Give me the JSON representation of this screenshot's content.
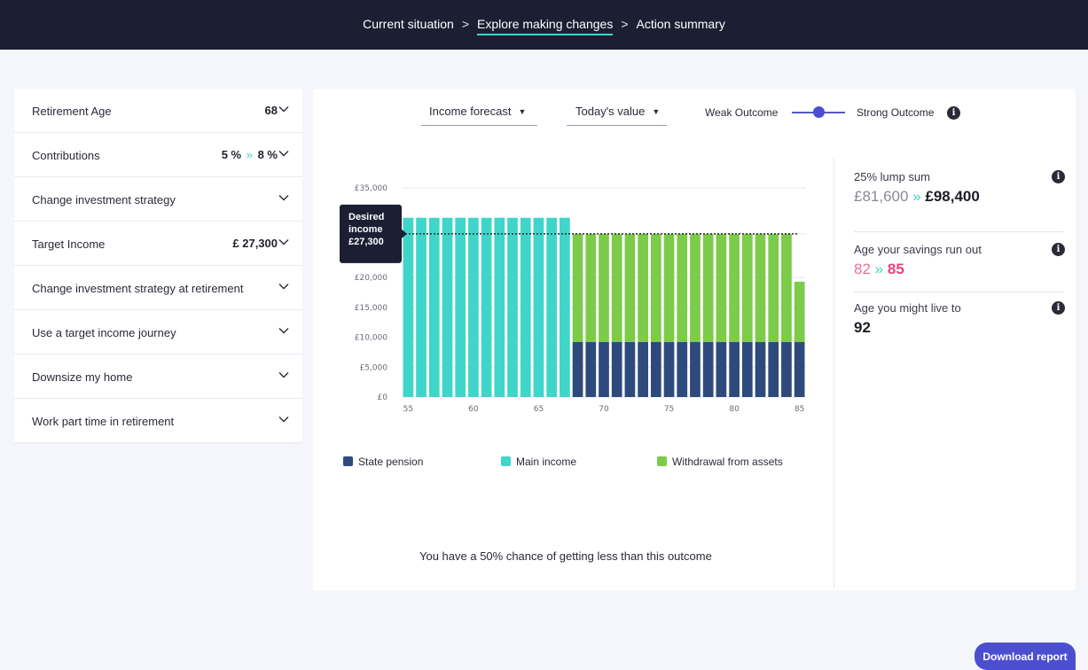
{
  "breadcrumb": {
    "items": [
      "Current situation",
      "Explore making changes",
      "Action summary"
    ],
    "separator": ">",
    "active_index": 1
  },
  "sidebar": {
    "items": [
      {
        "label": "Retirement Age",
        "value": "68"
      },
      {
        "label": "Contributions",
        "value_from": "5 %",
        "arrows": "»",
        "value_to": "8 %"
      },
      {
        "label": "Change investment strategy",
        "value": ""
      },
      {
        "label": "Target Income",
        "value": "£ 27,300"
      },
      {
        "label": "Change investment strategy at retirement",
        "value": ""
      },
      {
        "label": "Use a target income journey",
        "value": ""
      },
      {
        "label": "Downsize my home",
        "value": ""
      },
      {
        "label": "Work part time in retirement",
        "value": ""
      }
    ]
  },
  "controls": {
    "forecast_select": "Income forecast",
    "value_select": "Today's value",
    "weak_label": "Weak Outcome",
    "strong_label": "Strong Outcome",
    "outcome_level": 0.5
  },
  "chart_data": {
    "type": "bar",
    "stacked": true,
    "x": [
      55,
      56,
      57,
      58,
      59,
      60,
      61,
      62,
      63,
      64,
      65,
      66,
      67,
      68,
      69,
      70,
      71,
      72,
      73,
      74,
      75,
      76,
      77,
      78,
      79,
      80,
      81,
      82,
      83,
      84,
      85
    ],
    "series": [
      {
        "name": "State pension",
        "color": "#2e4a7d",
        "values": [
          0,
          0,
          0,
          0,
          0,
          0,
          0,
          0,
          0,
          0,
          0,
          0,
          0,
          9200,
          9200,
          9200,
          9200,
          9200,
          9200,
          9200,
          9200,
          9200,
          9200,
          9200,
          9200,
          9200,
          9200,
          9200,
          9200,
          9200,
          9200
        ]
      },
      {
        "name": "Main income",
        "color": "#3fd6c9",
        "values": [
          30000,
          30000,
          30000,
          30000,
          30000,
          30000,
          30000,
          30000,
          30000,
          30000,
          30000,
          30000,
          30000,
          0,
          0,
          0,
          0,
          0,
          0,
          0,
          0,
          0,
          0,
          0,
          0,
          0,
          0,
          0,
          0,
          0,
          0
        ]
      },
      {
        "name": "Withdrawal from assets",
        "color": "#7ccb4a",
        "values": [
          0,
          0,
          0,
          0,
          0,
          0,
          0,
          0,
          0,
          0,
          0,
          0,
          0,
          18100,
          18100,
          18100,
          18100,
          18100,
          18100,
          18100,
          18100,
          18100,
          18100,
          18100,
          18100,
          18100,
          18100,
          18100,
          18100,
          18100,
          10100
        ]
      }
    ],
    "y_ticks": [
      "£0",
      "£5,000",
      "£10,000",
      "£15,000",
      "£20,000",
      "£27,300",
      "£35,000"
    ],
    "y_tick_values": [
      0,
      5000,
      10000,
      15000,
      20000,
      27300,
      35000
    ],
    "x_ticks": [
      "55",
      "60",
      "65",
      "70",
      "75",
      "80",
      "85"
    ],
    "x_tick_values": [
      55,
      60,
      65,
      70,
      75,
      80,
      85
    ],
    "ylim": [
      0,
      35000
    ],
    "target_line": 27300,
    "target_label": [
      "Desired",
      "income",
      "£27,300"
    ],
    "grid": true,
    "legend": "bottom"
  },
  "chance_text": "You have a 50% chance of getting less than this outcome",
  "stats": {
    "lump_sum": {
      "title": "25% lump sum",
      "from": "£81,600",
      "arrows": "»",
      "to": "£98,400"
    },
    "run_out": {
      "title": "Age your savings run out",
      "from": "82",
      "arrows": "»",
      "to": "85"
    },
    "live_to": {
      "title": "Age you might live to",
      "value": "92"
    }
  },
  "info_glyph": "i",
  "download_label": "Download report",
  "colors": {
    "accent": "#4b4fcf",
    "teal": "#3fd6c9",
    "navy": "#2e4a7d",
    "green": "#7ccb4a",
    "pink": "#e8407f",
    "topbar": "#1c1f33"
  }
}
